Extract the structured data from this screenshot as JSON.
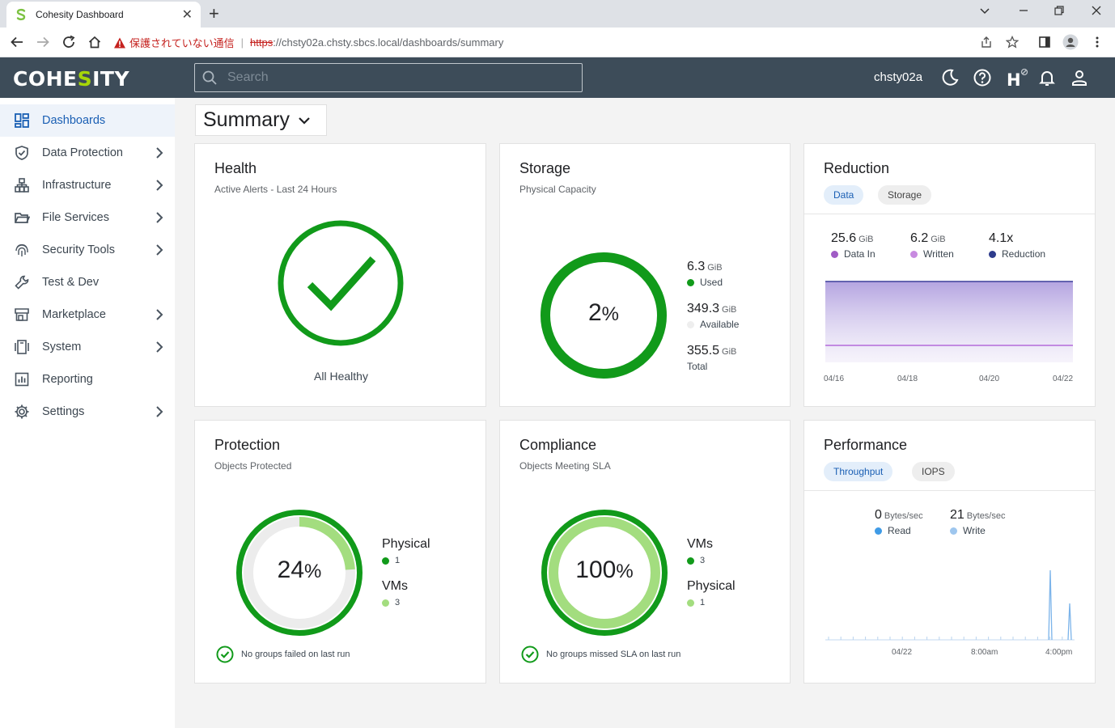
{
  "browser": {
    "tab_title": "Cohesity Dashboard",
    "security_warning": "保護されていない通信",
    "url_protocol": "https",
    "url_rest": "://chsty02a.chsty.sbcs.local/dashboards/summary"
  },
  "header": {
    "logo_left": "COHE",
    "logo_accent": "S",
    "logo_right": "ITY",
    "search_placeholder": "Search",
    "cluster_name": "chsty02a",
    "colors": {
      "bar": "#3d4c59",
      "logo_accent": "#a6d608"
    }
  },
  "sidebar": {
    "items": [
      {
        "label": "Dashboards",
        "icon": "dashboard-icon",
        "active": true,
        "chevron": false
      },
      {
        "label": "Data Protection",
        "icon": "shield-check-icon",
        "chevron": true
      },
      {
        "label": "Infrastructure",
        "icon": "infrastructure-icon",
        "chevron": true
      },
      {
        "label": "File Services",
        "icon": "folder-icon",
        "chevron": true
      },
      {
        "label": "Security Tools",
        "icon": "fingerprint-icon",
        "chevron": true
      },
      {
        "label": "Test & Dev",
        "icon": "wrench-icon",
        "chevron": false
      },
      {
        "label": "Marketplace",
        "icon": "store-icon",
        "chevron": true
      },
      {
        "label": "System",
        "icon": "system-icon",
        "chevron": true
      },
      {
        "label": "Reporting",
        "icon": "chart-icon",
        "chevron": false
      },
      {
        "label": "Settings",
        "icon": "gear-icon",
        "chevron": true
      }
    ]
  },
  "main": {
    "dashboard_selector": "Summary",
    "health": {
      "title": "Health",
      "subtitle": "Active Alerts - Last 24 Hours",
      "status": "All Healthy"
    },
    "storage": {
      "title": "Storage",
      "subtitle": "Physical Capacity",
      "percent_used": 2,
      "percent_label": "2",
      "percent_sign": "%",
      "used_value": "6.3",
      "used_unit": "GiB",
      "used_label": "Used",
      "available_value": "349.3",
      "available_unit": "GiB",
      "available_label": "Available",
      "total_value": "355.5",
      "total_unit": "GiB",
      "total_label": "Total"
    },
    "reduction": {
      "title": "Reduction",
      "tab_data": "Data",
      "tab_storage": "Storage",
      "data_in_value": "25.6",
      "data_in_unit": "GiB",
      "data_in_label": "Data In",
      "written_value": "6.2",
      "written_unit": "GiB",
      "written_label": "Written",
      "reduction_value": "4.1x",
      "reduction_label": "Reduction",
      "x_ticks": [
        "04/16",
        "04/18",
        "04/20",
        "04/22"
      ]
    },
    "protection": {
      "title": "Protection",
      "subtitle": "Objects Protected",
      "percent": 24,
      "percent_label": "24",
      "percent_sign": "%",
      "physical_label": "Physical",
      "physical_count": "1",
      "vms_label": "VMs",
      "vms_count": "3",
      "note": "No groups failed on last run"
    },
    "compliance": {
      "title": "Compliance",
      "subtitle": "Objects Meeting SLA",
      "percent": 100,
      "percent_label": "100",
      "percent_sign": "%",
      "vms_label": "VMs",
      "vms_count": "3",
      "physical_label": "Physical",
      "physical_count": "1",
      "note": "No groups missed SLA on last run"
    },
    "performance": {
      "title": "Performance",
      "tab_throughput": "Throughput",
      "tab_iops": "IOPS",
      "read_value": "0",
      "read_unit": "Bytes/sec",
      "read_label": "Read",
      "write_value": "21",
      "write_unit": "Bytes/sec",
      "write_label": "Write",
      "x_ticks": [
        "04/22",
        "8:00am",
        "4:00pm"
      ]
    },
    "colors": {
      "green_dark": "#119a1a",
      "green_light": "#a3dd7f",
      "purple": "#8e6cc4",
      "blue_dark": "#2e3c8c",
      "blue_read": "#3f9be6",
      "blue_write": "#9ec6ee"
    }
  }
}
